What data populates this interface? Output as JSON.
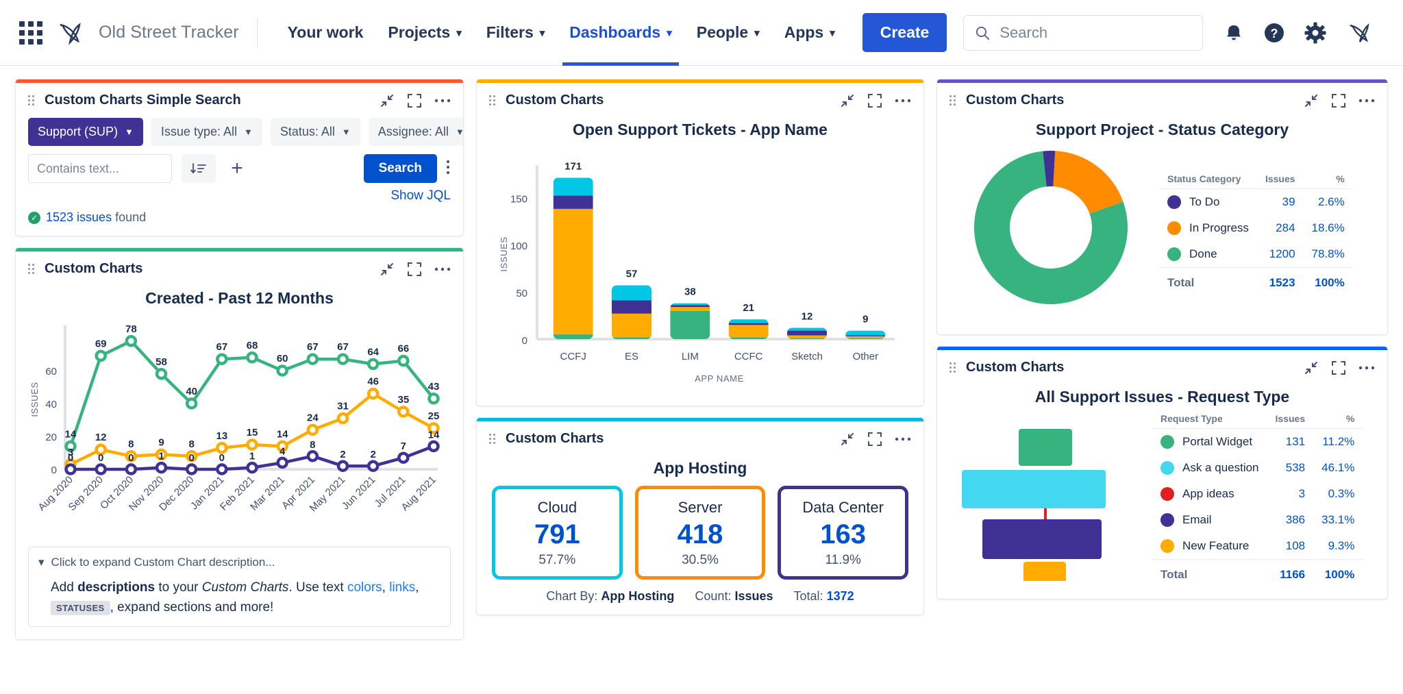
{
  "nav": {
    "app_switcher": "apps-grid-icon",
    "logo": "jira-logo",
    "product_name": "Old Street Tracker",
    "items": [
      {
        "label": "Your work",
        "has_caret": false,
        "active": false
      },
      {
        "label": "Projects",
        "has_caret": true,
        "active": false
      },
      {
        "label": "Filters",
        "has_caret": true,
        "active": false
      },
      {
        "label": "Dashboards",
        "has_caret": true,
        "active": true
      },
      {
        "label": "People",
        "has_caret": true,
        "active": false
      },
      {
        "label": "Apps",
        "has_caret": true,
        "active": false
      }
    ],
    "create_label": "Create",
    "search_placeholder": "Search",
    "icons": [
      "notifications-icon",
      "help-icon",
      "settings-icon",
      "profile-avatar"
    ]
  },
  "gadgets": {
    "simple_search": {
      "title": "Custom Charts Simple Search",
      "accent": "#ff5630",
      "filters": [
        {
          "label": "Support (SUP)",
          "style": "primary"
        },
        {
          "label": "Issue type: All",
          "style": "plain"
        },
        {
          "label": "Status: All",
          "style": "plain"
        },
        {
          "label": "Assignee: All",
          "style": "plain"
        }
      ],
      "text_placeholder": "Contains text...",
      "search_label": "Search",
      "show_jql_label": "Show JQL",
      "result_count": "1523 issues",
      "result_suffix": " found"
    },
    "created_line": {
      "title": "Custom Charts",
      "accent": "#36b37e",
      "description_toggle": "Click to expand Custom Chart description...",
      "desc_p1": "Add ",
      "desc_b1": "descriptions",
      "desc_p2": " to your ",
      "desc_i1": "Custom Charts",
      "desc_p3": ". Use text ",
      "desc_link1": "colors",
      "desc_p4": ", ",
      "desc_link2": "links",
      "desc_p5": ",",
      "desc_badge": "STATUSES",
      "desc_p6": ", expand sections and more!"
    },
    "bar": {
      "title": "Custom Charts",
      "accent": "#ffab00"
    },
    "hosting": {
      "title": "Custom Charts",
      "accent": "#00b8d9",
      "chart_title": "App Hosting",
      "boxes": [
        {
          "label": "Cloud",
          "value": "791",
          "pct": "57.7%",
          "color": "#00c7e6"
        },
        {
          "label": "Server",
          "value": "418",
          "pct": "30.5%",
          "color": "#ff8b00"
        },
        {
          "label": "Data Center",
          "value": "163",
          "pct": "11.9%",
          "color": "#403294"
        }
      ],
      "foot_chartby_label": "Chart By:",
      "foot_chartby_value": "App Hosting",
      "foot_count_label": "Count:",
      "foot_count_value": "Issues",
      "foot_total_label": "Total:",
      "foot_total_value": "1372"
    },
    "donut": {
      "title": "Custom Charts",
      "accent": "#6554c0"
    },
    "request_type": {
      "title": "Custom Charts",
      "accent": "#0065ff"
    }
  },
  "chart_data": [
    {
      "type": "line",
      "id": "created-past-12-months",
      "title": "Created - Past 12 Months",
      "xlabel": "",
      "ylabel": "ISSUES",
      "ylim": [
        0,
        85
      ],
      "yticks": [
        0,
        20,
        40,
        60
      ],
      "categories": [
        "Aug 2020",
        "Sep 2020",
        "Oct 2020",
        "Nov 2020",
        "Dec 2020",
        "Jan 2021",
        "Feb 2021",
        "Mar 2021",
        "Apr 2021",
        "May 2021",
        "Jun 2021",
        "Jul 2021",
        "Aug 2021"
      ],
      "series": [
        {
          "name": "Green",
          "color": "#36b37e",
          "values": [
            14,
            69,
            78,
            58,
            40,
            67,
            68,
            60,
            67,
            67,
            64,
            66,
            43
          ]
        },
        {
          "name": "Yellow",
          "color": "#ffab00",
          "values": [
            3,
            12,
            8,
            9,
            8,
            13,
            15,
            14,
            24,
            31,
            46,
            35,
            25
          ]
        },
        {
          "name": "Purple",
          "color": "#403294",
          "values": [
            0,
            0,
            0,
            1,
            0,
            0,
            1,
            4,
            8,
            2,
            2,
            7,
            14
          ]
        }
      ]
    },
    {
      "type": "bar",
      "id": "open-support-tickets-app-name",
      "title": "Open Support Tickets - App Name",
      "xlabel": "APP NAME",
      "ylabel": "ISSUES",
      "ylim": [
        0,
        180
      ],
      "yticks": [
        0,
        50,
        100,
        150
      ],
      "stacked": true,
      "categories": [
        "CCFJ",
        "ES",
        "LIM",
        "CCFC",
        "Sketch",
        "Other"
      ],
      "totals": [
        171,
        57,
        38,
        21,
        12,
        9
      ],
      "series": [
        {
          "name": "Green",
          "color": "#36b37e",
          "values": [
            5,
            2,
            30,
            2,
            1,
            1
          ]
        },
        {
          "name": "Yellow",
          "color": "#ffab00",
          "values": [
            133,
            25,
            4,
            13,
            3,
            2
          ]
        },
        {
          "name": "Purple",
          "color": "#403294",
          "values": [
            14,
            14,
            2,
            2,
            5,
            1
          ]
        },
        {
          "name": "Cyan",
          "color": "#00c7e6",
          "values": [
            19,
            16,
            2,
            4,
            3,
            5
          ]
        }
      ]
    },
    {
      "type": "pie",
      "id": "support-project-status-category",
      "title": "Support Project - Status Category",
      "donut": true,
      "columns": [
        "Status Category",
        "Issues",
        "%"
      ],
      "rows": [
        {
          "label": "To Do",
          "issues": "39",
          "pct": "2.6%",
          "value": 39,
          "color": "#403294"
        },
        {
          "label": "In Progress",
          "issues": "284",
          "pct": "18.6%",
          "value": 284,
          "color": "#ff8b00"
        },
        {
          "label": "Done",
          "issues": "1200",
          "pct": "78.8%",
          "value": 1200,
          "color": "#36b37e"
        }
      ],
      "total_label": "Total",
      "total_issues": "1523",
      "total_pct": "100%"
    },
    {
      "type": "bar",
      "id": "all-support-issues-request-type",
      "title": "All Support Issues - Request Type",
      "columns": [
        "Request Type",
        "Issues",
        "%"
      ],
      "rows": [
        {
          "label": "Portal Widget",
          "issues": "131",
          "pct": "11.2%",
          "value": 131,
          "color": "#36b37e"
        },
        {
          "label": "Ask a question",
          "issues": "538",
          "pct": "46.1%",
          "value": 538,
          "color": "#44d7f0"
        },
        {
          "label": "App ideas",
          "issues": "3",
          "pct": "0.3%",
          "value": 3,
          "color": "#e02020"
        },
        {
          "label": "Email",
          "issues": "386",
          "pct": "33.1%",
          "value": 386,
          "color": "#403294"
        },
        {
          "label": "New Feature",
          "issues": "108",
          "pct": "9.3%",
          "value": 108,
          "color": "#ffab00"
        }
      ],
      "total_label": "Total",
      "total_issues": "1166",
      "total_pct": "100%"
    }
  ]
}
